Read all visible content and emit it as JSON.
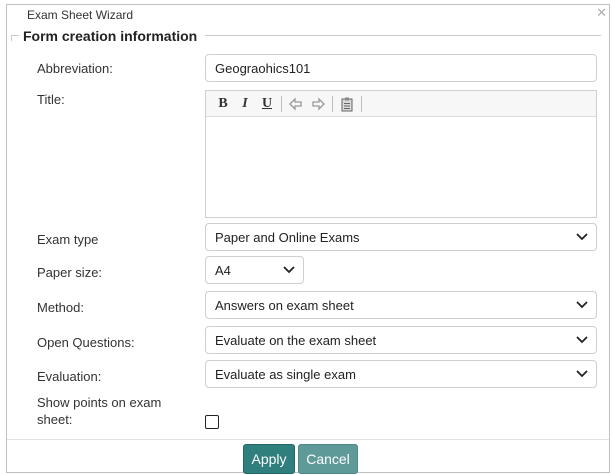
{
  "window": {
    "title": "Exam Sheet Wizard",
    "close_glyph": "✕"
  },
  "section": {
    "title": "Form creation information"
  },
  "abbreviation": {
    "label": "Abbreviation:",
    "value": "Geograohics101"
  },
  "title_field": {
    "label": "Title:",
    "toolbar": [
      "bold-icon",
      "italic-icon",
      "underline-icon",
      "undo-icon",
      "redo-icon",
      "paste-icon"
    ],
    "toolbar_glyphs": {
      "bold": "B",
      "italic": "I",
      "underline": "U"
    },
    "value": ""
  },
  "exam_type": {
    "label": "Exam type",
    "value": "Paper and Online Exams"
  },
  "paper_size": {
    "label": "Paper size:",
    "value": "A4"
  },
  "method": {
    "label": "Method:",
    "value": "Answers on exam sheet"
  },
  "open_questions": {
    "label": "Open Questions:",
    "value": "Evaluate on the exam sheet"
  },
  "evaluation": {
    "label": "Evaluation:",
    "value": "Evaluate as single exam"
  },
  "show_points": {
    "label": "Show points on exam sheet:",
    "checked": false
  },
  "buttons": {
    "apply": "Apply",
    "cancel": "Cancel"
  },
  "colors": {
    "button_primary": "#2e7f7d",
    "button_secondary": "#5e9a98"
  }
}
